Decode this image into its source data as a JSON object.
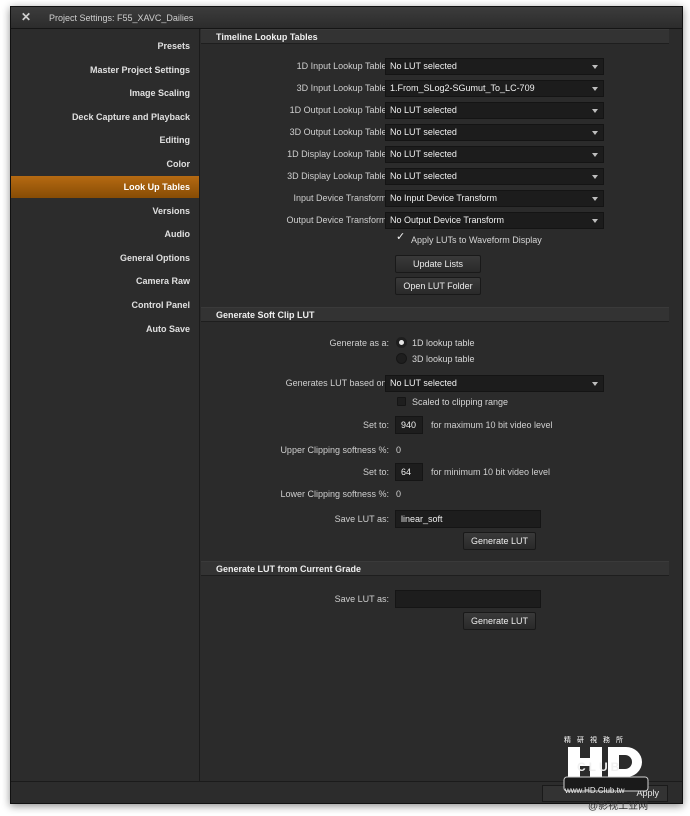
{
  "window": {
    "title": "Project Settings:  F55_XAVC_Dailies"
  },
  "sidebar": {
    "items": [
      {
        "label": "Presets"
      },
      {
        "label": "Master Project Settings"
      },
      {
        "label": "Image Scaling"
      },
      {
        "label": "Deck Capture and Playback"
      },
      {
        "label": "Editing"
      },
      {
        "label": "Color"
      },
      {
        "label": "Look Up Tables",
        "active": true
      },
      {
        "label": "Versions"
      },
      {
        "label": "Audio"
      },
      {
        "label": "General Options"
      },
      {
        "label": "Camera Raw"
      },
      {
        "label": "Control Panel"
      },
      {
        "label": "Auto Save"
      }
    ]
  },
  "timeline": {
    "header": "Timeline Lookup Tables",
    "rows": [
      {
        "label": "1D Input Lookup Table:",
        "value": "No LUT selected"
      },
      {
        "label": "3D Input Lookup Table:",
        "value": "1.From_SLog2-SGumut_To_LC-709"
      },
      {
        "label": "1D Output Lookup Table:",
        "value": "No LUT selected"
      },
      {
        "label": "3D Output Lookup Table:",
        "value": "No LUT selected"
      },
      {
        "label": "1D Display Lookup Table:",
        "value": "No LUT selected"
      },
      {
        "label": "3D Display Lookup Table:",
        "value": "No LUT selected"
      },
      {
        "label": "Input Device Transform:",
        "value": "No Input Device Transform"
      },
      {
        "label": "Output Device Transform:",
        "value": "No Output Device Transform"
      }
    ],
    "apply_waveform": {
      "label": "Apply LUTs to Waveform Display",
      "checked": true
    },
    "update_lists": "Update Lists",
    "open_folder": "Open LUT Folder"
  },
  "softclip": {
    "header": "Generate Soft Clip LUT",
    "generate_as_label": "Generate as a:",
    "option_1d": "1D lookup table",
    "option_3d": "3D lookup table",
    "selected": "1D lookup table",
    "based_on_label": "Generates LUT based on:",
    "based_on_value": "No LUT selected",
    "scaled_label": "Scaled to clipping range",
    "scaled_checked": false,
    "set_to_label": "Set to:",
    "max_value": "940",
    "max_hint": "for maximum 10 bit video level",
    "upper_label": "Upper Clipping softness %:",
    "upper_value": "0",
    "min_value": "64",
    "min_hint": "for minimum 10 bit video level",
    "lower_label": "Lower Clipping softness %:",
    "lower_value": "0",
    "save_as_label": "Save LUT as:",
    "save_as_value": "linear_soft",
    "generate": "Generate LUT"
  },
  "grade": {
    "header": "Generate LUT from Current Grade",
    "save_as_label": "Save LUT as:",
    "save_as_value": "",
    "generate": "Generate LUT"
  },
  "footer": {
    "apply": "Apply"
  },
  "watermark": {
    "logo_top": "精研視務所",
    "logo_mid": "HD",
    "logo_club": "CLUB",
    "url": "www.HD.Club.tw",
    "credit": "@影视工业网"
  }
}
